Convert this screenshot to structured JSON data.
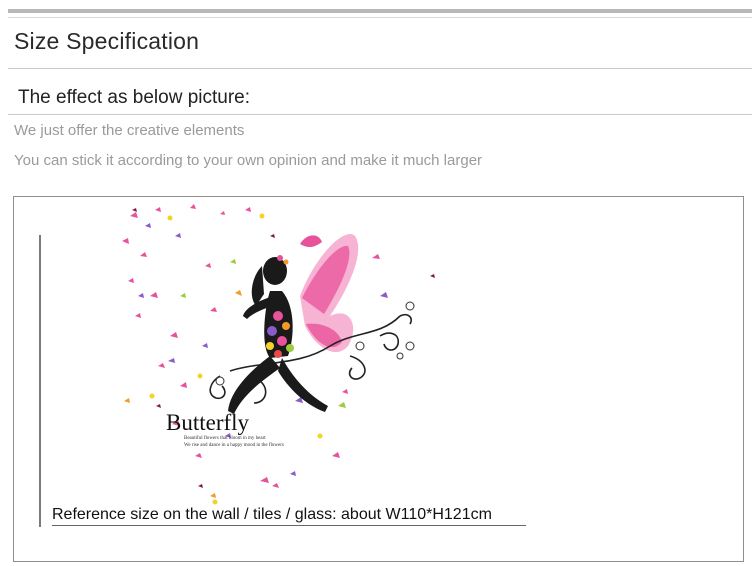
{
  "header": {
    "title": "Size Specification"
  },
  "intro": {
    "subtitle": "The effect as below picture:",
    "notes": [
      "We just offer the creative elements",
      "You can stick it according to your own opinion and make it much larger"
    ]
  },
  "product": {
    "brand_word": "Butterfly",
    "taglines": [
      "Beautiful flowers that bloom in my heart",
      "We rise and dance in a happy mood in the flowers"
    ],
    "reference_size": "Reference size on the wall / tiles / glass: about  W110*H121cm"
  },
  "colors": {
    "wing_pink": "#e8529a",
    "wing_light": "#f7b3d3",
    "silhouette": "#1a1a1a",
    "accent_orange": "#f39a2a",
    "accent_purple": "#8a5cc8",
    "accent_green": "#9ccc3c"
  }
}
